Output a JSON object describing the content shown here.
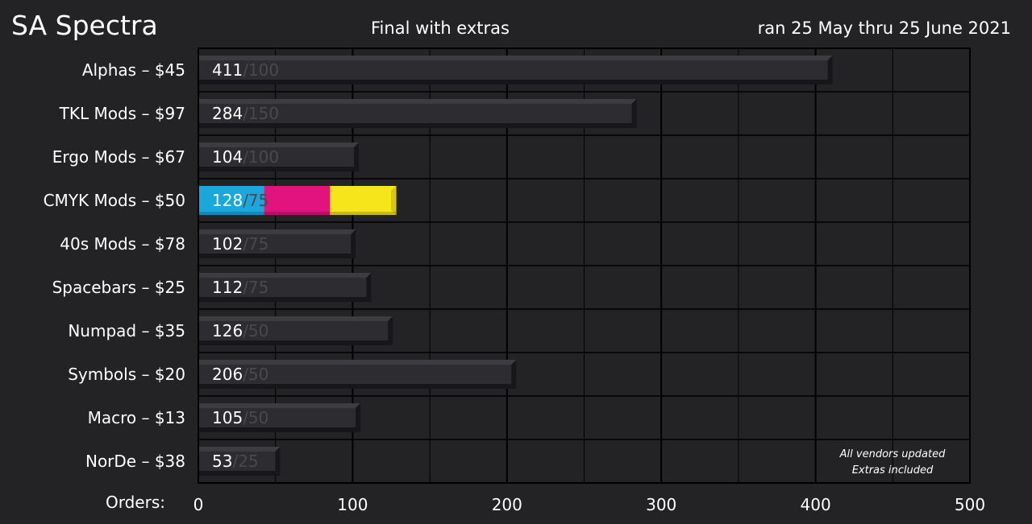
{
  "header": {
    "title": "SA Spectra",
    "subtitle": "Final with extras",
    "date_range": "ran 25 May thru 25 June 2021"
  },
  "chart_data": {
    "type": "bar",
    "orientation": "horizontal",
    "categories": [
      "Alphas – $45",
      "TKL Mods – $97",
      "Ergo Mods – $67",
      "CMYK Mods – $50",
      "40s Mods – $78",
      "Spacebars – $25",
      "Numpad – $35",
      "Symbols – $20",
      "Macro – $13",
      "NorDe – $38"
    ],
    "values": [
      411,
      284,
      104,
      128,
      102,
      112,
      126,
      206,
      105,
      53
    ],
    "targets": [
      100,
      150,
      100,
      75,
      75,
      75,
      50,
      50,
      50,
      25
    ],
    "xlabel": "Orders:",
    "xlim": [
      0,
      500
    ],
    "xticks": [
      0,
      100,
      200,
      300,
      400,
      500
    ],
    "grid": true,
    "notes": [
      "All vendors updated",
      "Extras included"
    ],
    "colors": {
      "bar": "#2d2c30",
      "bar_highlight": "#3d3c41",
      "bar_shadow": "#17161a",
      "cmyk": [
        "#1aa8dc",
        "#e2137e",
        "#f5e61c"
      ],
      "target_text": "#4a494d",
      "grid": "#000000",
      "background": "#232225"
    },
    "special_bar": {
      "category": "CMYK Mods – $50",
      "segment_colors": [
        "cyan",
        "magenta",
        "yellow"
      ],
      "value_text_color": "#000000"
    }
  }
}
